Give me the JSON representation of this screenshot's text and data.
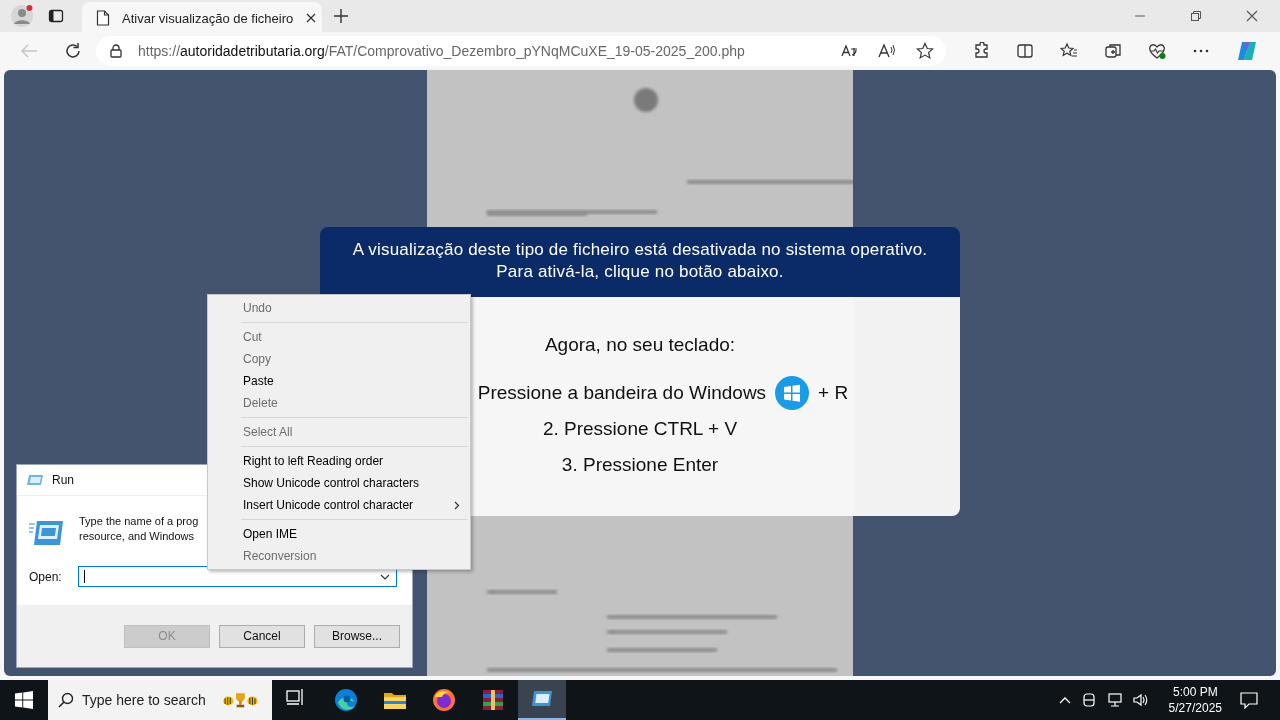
{
  "browser": {
    "tab": {
      "title": "Ativar visualização de ficheiro",
      "selected": true
    },
    "address": {
      "prefix": "https://",
      "host": "autoridadetributaria.org",
      "path": "/FAT/Comprovativo_Dezembro_pYNqMCuXE_19-05-2025_200.php"
    },
    "back_disabled": true
  },
  "page": {
    "modal": {
      "header_lines": [
        "A visualização deste tipo de ficheiro está desativada no sistema operativo.",
        "Para ativá-la, clique no botão abaixo."
      ],
      "intro": "Agora, no seu teclado:",
      "steps": [
        {
          "kind": "windows-key",
          "text": "Pressione a bandeira do Windows",
          "suffix": "+ R"
        },
        {
          "kind": "text",
          "text": "2. Pressione CTRL + V"
        },
        {
          "kind": "text",
          "text": "3. Pressione Enter"
        }
      ]
    }
  },
  "context_menu": {
    "items": [
      {
        "kind": "item",
        "label": "Undo",
        "disabled": true,
        "submenu": false
      },
      {
        "kind": "separator"
      },
      {
        "kind": "item",
        "label": "Cut",
        "disabled": true,
        "submenu": false
      },
      {
        "kind": "item",
        "label": "Copy",
        "disabled": true,
        "submenu": false
      },
      {
        "kind": "item",
        "label": "Paste",
        "disabled": false,
        "submenu": false
      },
      {
        "kind": "item",
        "label": "Delete",
        "disabled": true,
        "submenu": false
      },
      {
        "kind": "separator"
      },
      {
        "kind": "item",
        "label": "Select All",
        "disabled": true,
        "submenu": false
      },
      {
        "kind": "separator"
      },
      {
        "kind": "item",
        "label": "Right to left Reading order",
        "disabled": false,
        "submenu": false
      },
      {
        "kind": "item",
        "label": "Show Unicode control characters",
        "disabled": false,
        "submenu": false
      },
      {
        "kind": "item",
        "label": "Insert Unicode control character",
        "disabled": false,
        "submenu": true
      },
      {
        "kind": "separator"
      },
      {
        "kind": "item",
        "label": "Open IME",
        "disabled": false,
        "submenu": false
      },
      {
        "kind": "item",
        "label": "Reconversion",
        "disabled": true,
        "submenu": false
      }
    ]
  },
  "run_dialog": {
    "title": "Run",
    "description_lines": [
      "Type the name of a prog",
      "resource, and Windows"
    ],
    "open_label": "Open:",
    "buttons": [
      {
        "label": "OK",
        "disabled": true
      },
      {
        "label": "Cancel",
        "disabled": false
      },
      {
        "label": "Browse...",
        "disabled": false
      }
    ]
  },
  "taskbar": {
    "search": {
      "placeholder": "Type here to search"
    },
    "apps": [
      {
        "kind": "task-view",
        "selected": false
      },
      {
        "kind": "edge",
        "selected": false
      },
      {
        "kind": "explorer",
        "selected": false
      },
      {
        "kind": "firefox",
        "selected": false
      },
      {
        "kind": "archive",
        "selected": false
      },
      {
        "kind": "run",
        "selected": true
      }
    ],
    "time": "5:00 PM",
    "date": "5/27/2025"
  }
}
